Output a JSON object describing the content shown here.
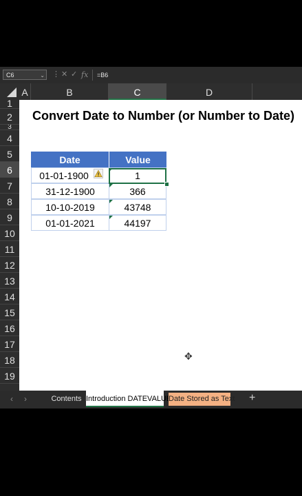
{
  "formula_bar": {
    "name_box": "C6",
    "formula": "=B6",
    "cancel_glyph": "✕",
    "enter_glyph": "✓",
    "fx_glyph": "fx"
  },
  "columns": [
    "A",
    "B",
    "C",
    "D"
  ],
  "selected_column": "C",
  "rows": [
    "1",
    "2",
    "3",
    "4",
    "5",
    "6",
    "7",
    "8",
    "9",
    "10",
    "11",
    "12",
    "13",
    "14",
    "15",
    "16",
    "17",
    "18",
    "19"
  ],
  "selected_row": "6",
  "sheet": {
    "title": "Convert Date to Number (or Number to Date)",
    "table": {
      "headers": [
        "Date",
        "Value"
      ],
      "rows": [
        {
          "date": "01-01-1900",
          "value": "1"
        },
        {
          "date": "31-12-1900",
          "value": "366"
        },
        {
          "date": "10-10-2019",
          "value": "43748"
        },
        {
          "date": "01-01-2021",
          "value": "44197"
        }
      ]
    },
    "header_color": "#4472c4",
    "accent_color": "#1e7145"
  },
  "icons": {
    "warning": "warning-icon",
    "cursor": "cell-cursor-icon"
  },
  "tabs": {
    "prev": "‹",
    "next": "›",
    "items": [
      {
        "label": "Contents"
      },
      {
        "label": "Introduction DATEVALUE",
        "active": true
      },
      {
        "label": "Date Stored as Text",
        "color": "#f4b183"
      }
    ],
    "add": "+"
  }
}
